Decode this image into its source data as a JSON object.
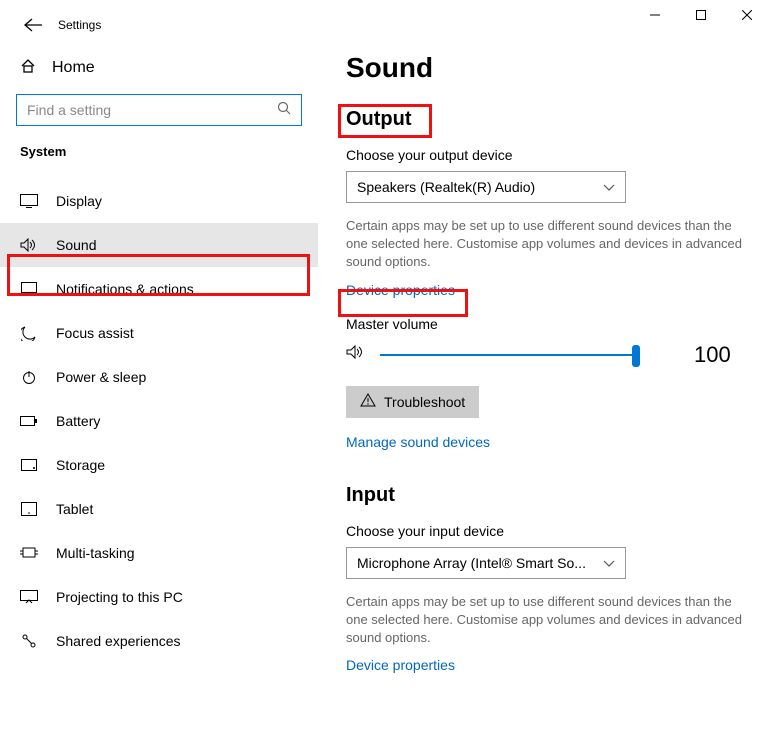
{
  "window": {
    "title": "Settings"
  },
  "sidebar": {
    "home": "Home",
    "search_placeholder": "Find a setting",
    "category": "System",
    "items": [
      {
        "label": "Display"
      },
      {
        "label": "Sound"
      },
      {
        "label": "Notifications & actions"
      },
      {
        "label": "Focus assist"
      },
      {
        "label": "Power & sleep"
      },
      {
        "label": "Battery"
      },
      {
        "label": "Storage"
      },
      {
        "label": "Tablet"
      },
      {
        "label": "Multi-tasking"
      },
      {
        "label": "Projecting to this PC"
      },
      {
        "label": "Shared experiences"
      }
    ]
  },
  "page": {
    "title": "Sound",
    "output": {
      "heading": "Output",
      "choose_label": "Choose your output device",
      "device": "Speakers (Realtek(R) Audio)",
      "hint": "Certain apps may be set up to use different sound devices than the one selected here. Customise app volumes and devices in advanced sound options.",
      "device_props": "Device properties",
      "master_label": "Master volume",
      "volume": "100",
      "troubleshoot": "Troubleshoot",
      "manage": "Manage sound devices"
    },
    "input": {
      "heading": "Input",
      "choose_label": "Choose your input device",
      "device": "Microphone Array (Intel® Smart So...",
      "hint": "Certain apps may be set up to use different sound devices than the one selected here. Customise app volumes and devices in advanced sound options.",
      "device_props": "Device properties"
    }
  }
}
